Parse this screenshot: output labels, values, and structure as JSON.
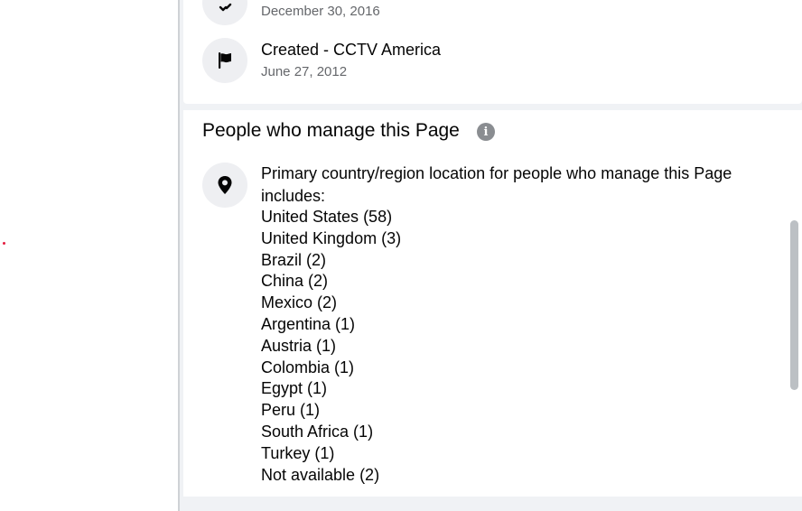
{
  "page_history": [
    {
      "icon": "name-change-icon",
      "title": "",
      "date": "December 30, 2016"
    },
    {
      "icon": "flag-icon",
      "title": "Created - CCTV America",
      "date": "June 27, 2012"
    }
  ],
  "managers_section": {
    "title": "People who manage this Page",
    "info_icon": "info-icon",
    "location_icon": "location-pin-icon",
    "intro": "Primary country/region location for people who manage this Page includes:",
    "locations": [
      {
        "label": "United States (58)"
      },
      {
        "label": "United Kingdom (3)"
      },
      {
        "label": "Brazil (2)"
      },
      {
        "label": "China (2)"
      },
      {
        "label": "Mexico (2)"
      },
      {
        "label": "Argentina (1)"
      },
      {
        "label": "Austria (1)"
      },
      {
        "label": "Colombia (1)"
      },
      {
        "label": "Egypt (1)"
      },
      {
        "label": "Peru (1)"
      },
      {
        "label": "South Africa (1)"
      },
      {
        "label": "Turkey (1)"
      },
      {
        "label": "Not available (2)"
      }
    ]
  },
  "colors": {
    "text_primary": "#050505",
    "text_secondary": "#65676b",
    "panel_background": "#f0f2f5",
    "icon_background": "#eeeff2",
    "scrollbar": "#bcc0c4"
  }
}
